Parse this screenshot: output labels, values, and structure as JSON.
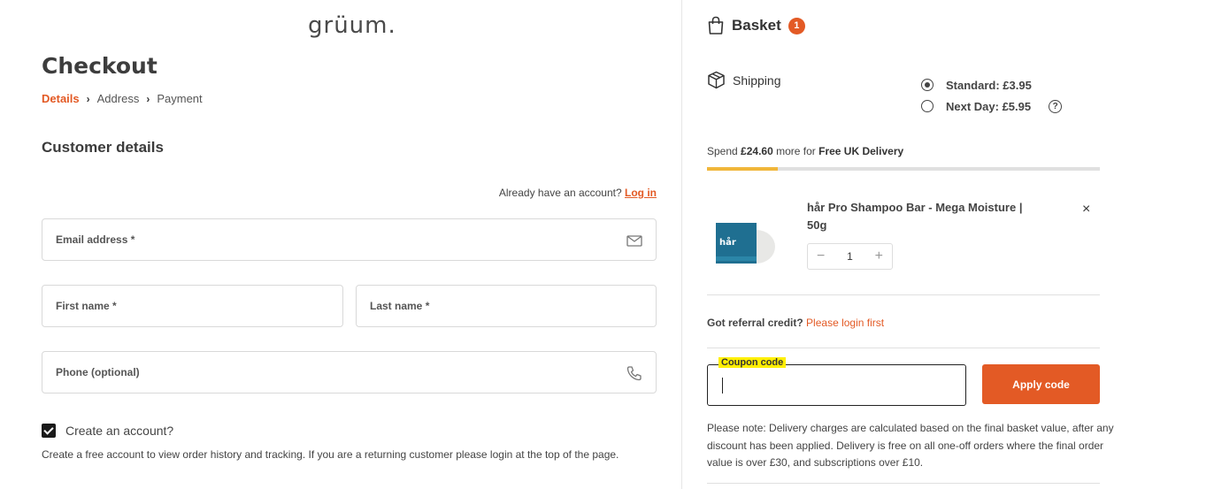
{
  "brand": {
    "logo": "grüum.",
    "accent": "#e35a25"
  },
  "checkout": {
    "title": "Checkout",
    "breadcrumb": {
      "step1": "Details",
      "step2": "Address",
      "step3": "Payment",
      "sep": "›"
    },
    "section_title": "Customer details",
    "account_prompt": "Already have an account?",
    "login_link": "Log in",
    "fields": {
      "email": "Email address *",
      "first_name": "First name *",
      "last_name": "Last name *",
      "phone": "Phone (optional)"
    },
    "create_account": {
      "label": "Create an account?",
      "checked": true
    },
    "create_account_note": "Create a free account to view order history and tracking. If you are a returning customer please login at the top of the page."
  },
  "basket": {
    "title": "Basket",
    "count": "1",
    "shipping_label": "Shipping",
    "shipping_options": [
      {
        "label": "Standard: £3.95",
        "selected": true
      },
      {
        "label": "Next Day: £5.95",
        "selected": false
      }
    ],
    "help_glyph": "?",
    "free_delivery": {
      "prefix": "Spend ",
      "amount": "£24.60",
      "middle": " more for ",
      "target": "Free UK Delivery",
      "progress_fraction": 0.18
    },
    "item": {
      "image_label": "hår",
      "name": "hår Pro Shampoo Bar - Mega Moisture | 50g",
      "quantity": "1",
      "minus": "−",
      "plus": "+",
      "remove": "×"
    },
    "referral": {
      "text": "Got referral credit?",
      "link": "Please login first"
    },
    "coupon": {
      "label": "Coupon code",
      "apply": "Apply code"
    },
    "note": "Please note: Delivery charges are calculated based on the final basket value, after any discount has been applied. Delivery is free on all one-off orders where the final order value is over £30, and subscriptions over £10."
  }
}
